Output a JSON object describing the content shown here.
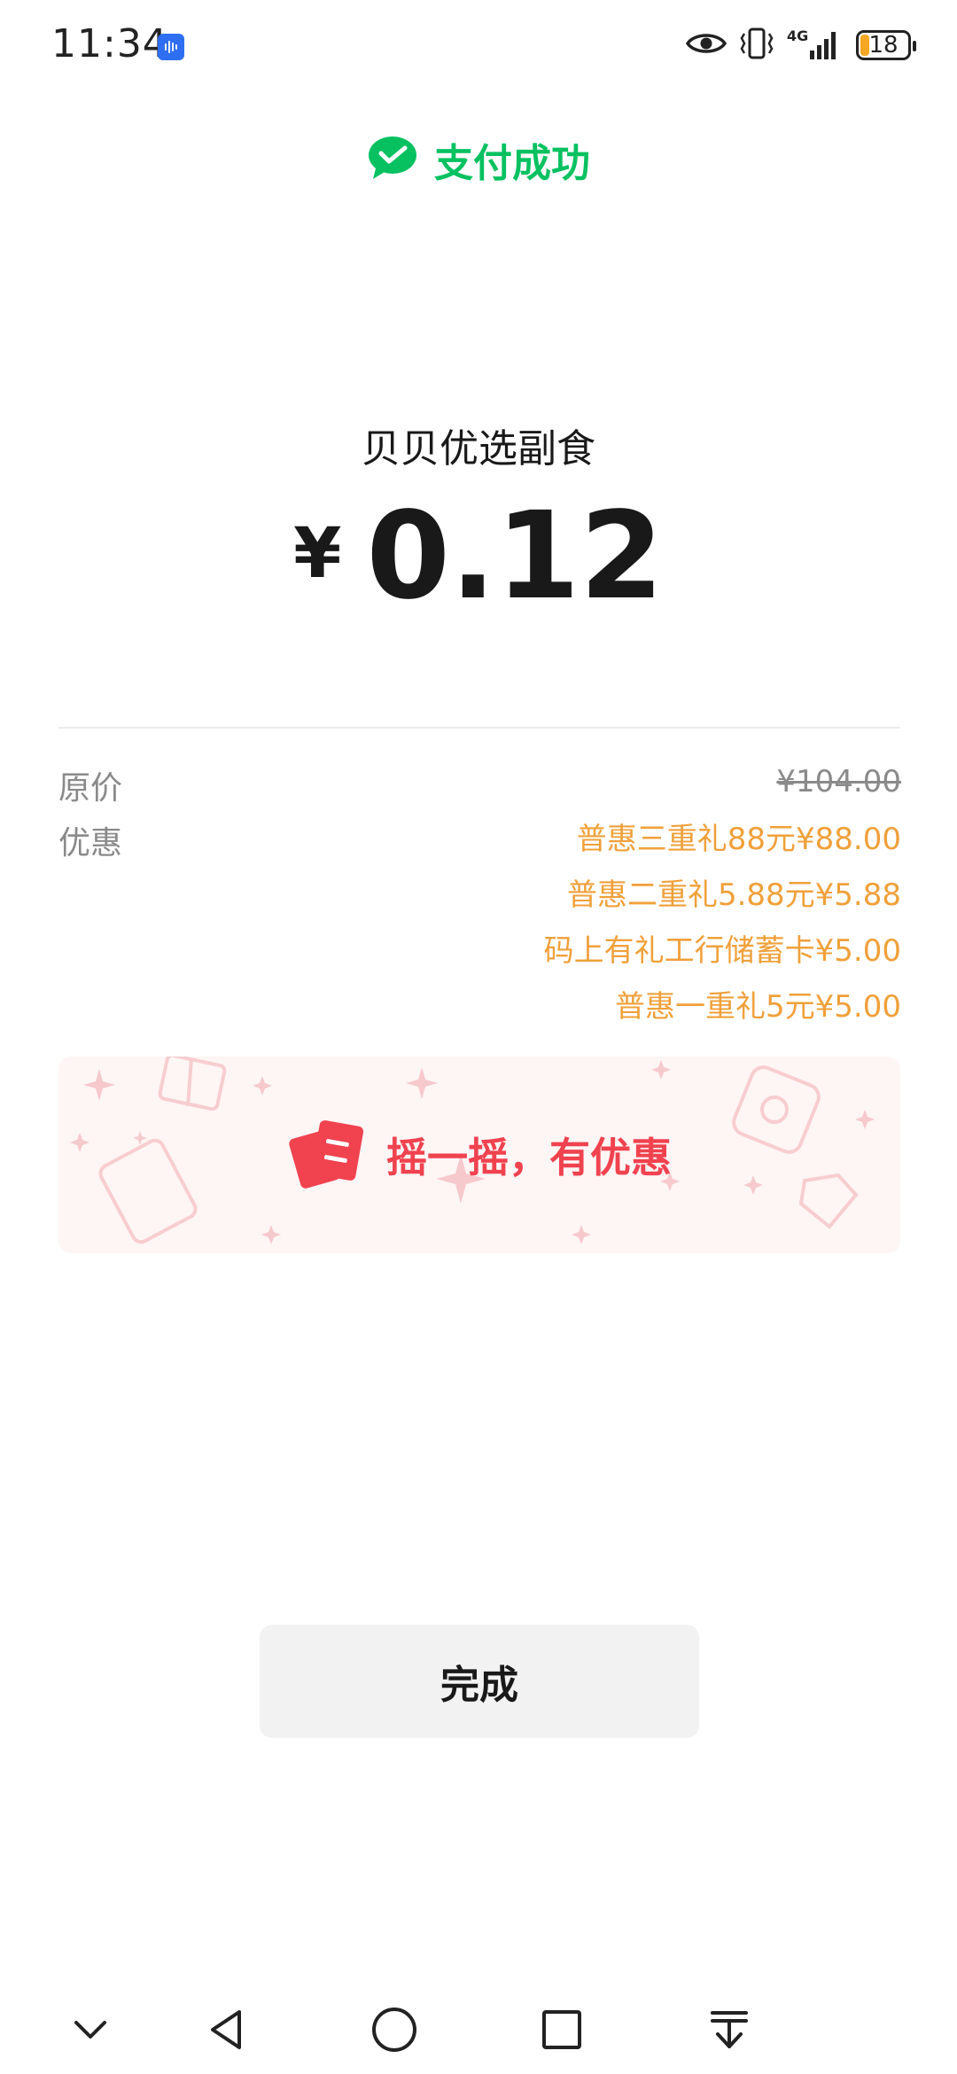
{
  "status_bar": {
    "time": "11:34",
    "network": "4G",
    "battery": "18",
    "icons": [
      "voice-assistant-icon",
      "eye-icon",
      "vibrate-icon",
      "signal-icon",
      "battery-icon"
    ]
  },
  "header": {
    "status_icon": "wechat-pay-check-icon",
    "status_label": "支付成功",
    "accent_color": "#07c160"
  },
  "payment": {
    "merchant": "贝贝优选副食",
    "currency_symbol": "¥",
    "amount": "0.12"
  },
  "details": {
    "original_label": "原价",
    "original_value": "¥104.00",
    "discount_label": "优惠",
    "discounts": [
      "普惠三重礼88元¥88.00",
      "普惠二重礼5.88元¥5.88",
      "码上有礼工行储蓄卡¥5.00",
      "普惠一重礼5元¥5.00"
    ],
    "discount_color": "#f0a03a"
  },
  "promo": {
    "icon": "shake-coupon-icon",
    "text": "摇一摇，有优惠",
    "color": "#f0424f"
  },
  "actions": {
    "done_label": "完成"
  },
  "nav_bar": {
    "icons": [
      "collapse-icon",
      "back-icon",
      "home-icon",
      "recents-icon",
      "pull-down-icon"
    ]
  }
}
